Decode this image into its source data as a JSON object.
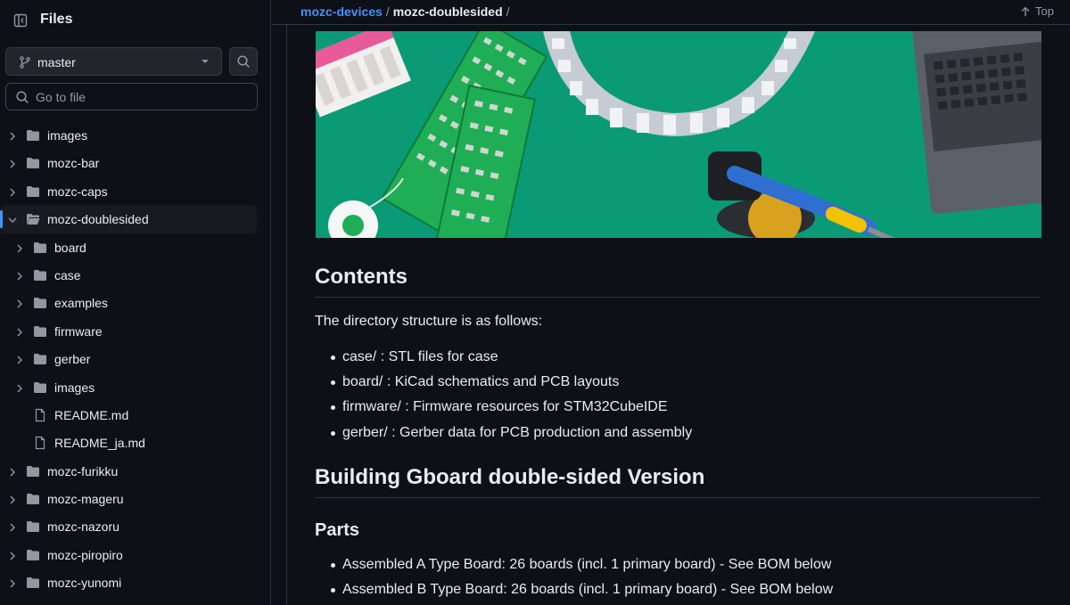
{
  "sidebar": {
    "title": "Files",
    "branch": "master",
    "goto_placeholder": "Go to file",
    "tree": [
      {
        "label": "images",
        "type": "folder",
        "level": 0,
        "expanded": false
      },
      {
        "label": "mozc-bar",
        "type": "folder",
        "level": 0,
        "expanded": false
      },
      {
        "label": "mozc-caps",
        "type": "folder",
        "level": 0,
        "expanded": false
      },
      {
        "label": "mozc-doublesided",
        "type": "folder",
        "level": 0,
        "expanded": true,
        "active": true
      },
      {
        "label": "board",
        "type": "folder",
        "level": 1,
        "expanded": false
      },
      {
        "label": "case",
        "type": "folder",
        "level": 1,
        "expanded": false
      },
      {
        "label": "examples",
        "type": "folder",
        "level": 1,
        "expanded": false
      },
      {
        "label": "firmware",
        "type": "folder",
        "level": 1,
        "expanded": false
      },
      {
        "label": "gerber",
        "type": "folder",
        "level": 1,
        "expanded": false
      },
      {
        "label": "images",
        "type": "folder",
        "level": 1,
        "expanded": false
      },
      {
        "label": "README.md",
        "type": "file",
        "level": 1
      },
      {
        "label": "README_ja.md",
        "type": "file",
        "level": 1
      },
      {
        "label": "mozc-furikku",
        "type": "folder",
        "level": 0,
        "expanded": false
      },
      {
        "label": "mozc-mageru",
        "type": "folder",
        "level": 0,
        "expanded": false
      },
      {
        "label": "mozc-nazoru",
        "type": "folder",
        "level": 0,
        "expanded": false
      },
      {
        "label": "mozc-piropiro",
        "type": "folder",
        "level": 0,
        "expanded": false
      },
      {
        "label": "mozc-yunomi",
        "type": "folder",
        "level": 0,
        "expanded": false
      }
    ]
  },
  "breadcrumb": {
    "repo": "mozc-devices",
    "sep1": "/",
    "current": "mozc-doublesided",
    "sep2": "/"
  },
  "top_link": "Top",
  "readme": {
    "contents_heading": "Contents",
    "intro": "The directory structure is as follows:",
    "dirs": [
      "case/ : STL files for case",
      "board/ : KiCad schematics and PCB layouts",
      "firmware/ : Firmware resources for STM32CubeIDE",
      "gerber/ : Gerber data for PCB production and assembly"
    ],
    "build_heading": "Building Gboard double-sided Version",
    "parts_heading": "Parts",
    "parts": [
      "Assembled A Type Board: 26 boards (incl. 1 primary board) - See BOM below",
      "Assembled B Type Board: 26 boards (incl. 1 primary board) - See BOM below"
    ]
  },
  "colors": {
    "accent": "#4493f8",
    "bg": "#0d1117",
    "hero_green": "#0e9e79"
  },
  "icons": {
    "panel": "sidebar-collapse-icon",
    "branch": "git-branch-icon",
    "search": "search-icon",
    "folder": "folder-icon",
    "file": "file-icon",
    "arrow_up": "arrow-up-icon"
  }
}
